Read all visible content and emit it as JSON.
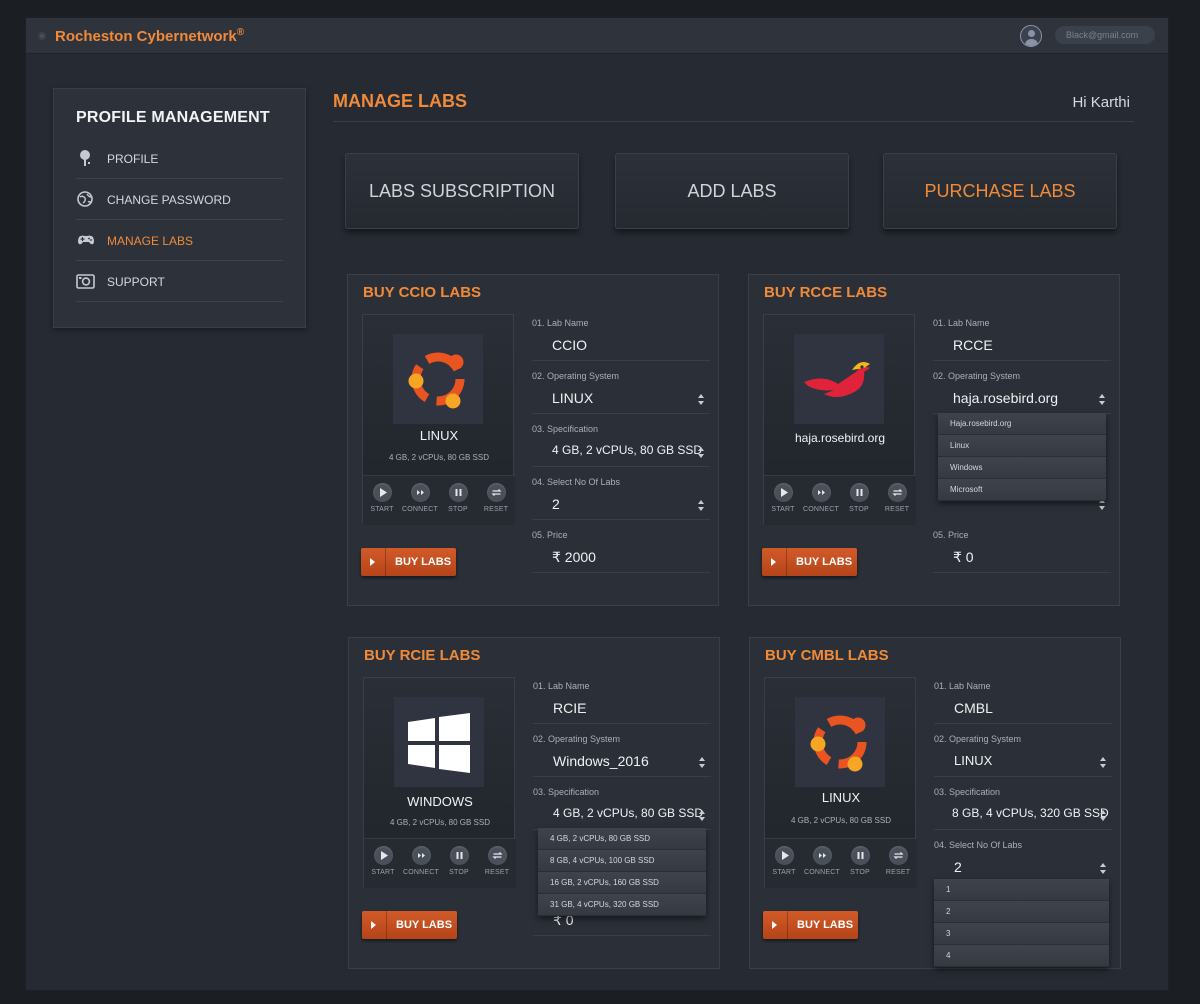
{
  "header": {
    "brand": "Rocheston Cybernetwork",
    "brand_mark": "®",
    "email": "Black@gmail.com"
  },
  "sidebar": {
    "title": "PROFILE MANAGEMENT",
    "items": [
      {
        "label": "PROFILE",
        "icon": "profile-icon",
        "active": false
      },
      {
        "label": "CHANGE PASSWORD",
        "icon": "globe-icon",
        "active": false
      },
      {
        "label": "MANAGE LABS",
        "icon": "gamepad-icon",
        "active": true
      },
      {
        "label": "SUPPORT",
        "icon": "camera-icon",
        "active": false
      }
    ]
  },
  "main": {
    "title": "MANAGE LABS",
    "greeting": "Hi Karthi",
    "actions": [
      "LABS SUBSCRIPTION",
      "ADD LABS",
      "PURCHASE LABS"
    ]
  },
  "controls": [
    "START",
    "CONNECT",
    "STOP",
    "RESET"
  ],
  "buy_label": "BUY LABS",
  "cards": [
    {
      "title": "BUY CCIO LABS",
      "os_name": "LINUX",
      "os_spec": "4 GB, 2 vCPUs, 80 GB SSD",
      "fields": [
        {
          "label": "01.  Lab Name",
          "value": "CCIO"
        },
        {
          "label": "02.  Operating System",
          "value": "LINUX"
        },
        {
          "label": "03.  Specification",
          "value": "4 GB, 2 vCPUs, 80 GB SSD"
        },
        {
          "label": "04.  Select No Of Labs",
          "value": "2"
        },
        {
          "label": "05.  Price",
          "value": "₹ 2000"
        }
      ]
    },
    {
      "title": "BUY RCCE LABS",
      "os_name": "haja.rosebird.org",
      "fields": [
        {
          "label": "01.  Lab Name",
          "value": "RCCE"
        },
        {
          "label": "02.  Operating System",
          "value": "haja.rosebird.org"
        },
        {
          "label": "05.  Price",
          "value": "₹ 0"
        }
      ],
      "dropdown": [
        "Haja.rosebird.org",
        "Linux",
        "Windows",
        "Microsoft"
      ]
    },
    {
      "title": "BUY RCIE LABS",
      "os_name": "WINDOWS",
      "os_spec": "4 GB, 2 vCPUs, 80 GB SSD",
      "fields": [
        {
          "label": "01.  Lab Name",
          "value": "RCIE"
        },
        {
          "label": "02.  Operating System",
          "value": "Windows_2016"
        },
        {
          "label": "03.  Specification",
          "value": "4 GB, 2 vCPUs, 80 GB SSD"
        },
        {
          "label": "",
          "value": "₹ 0"
        }
      ],
      "dropdown": [
        "4 GB, 2 vCPUs, 80 GB SSD",
        "8 GB, 4 vCPUs, 100 GB SSD",
        "16 GB, 2 vCPUs, 160 GB SSD",
        "31 GB, 4 vCPUs, 320 GB SSD"
      ]
    },
    {
      "title": "BUY CMBL LABS",
      "os_name": "LINUX",
      "os_spec": "4 GB, 2 vCPUs, 80 GB SSD",
      "fields": [
        {
          "label": "01.  Lab Name",
          "value": "CMBL"
        },
        {
          "label": "02.  Operating System",
          "value": "LINUX"
        },
        {
          "label": "03.  Specification",
          "value": "8 GB, 4 vCPUs, 320 GB SSD"
        },
        {
          "label": "04.  Select No Of Labs",
          "value": "2"
        }
      ],
      "dropdown": [
        "1",
        "2",
        "3",
        "4"
      ]
    }
  ],
  "colors": {
    "accent": "#f08a3a",
    "buy": "#c44d1f",
    "background": "#262b33"
  }
}
